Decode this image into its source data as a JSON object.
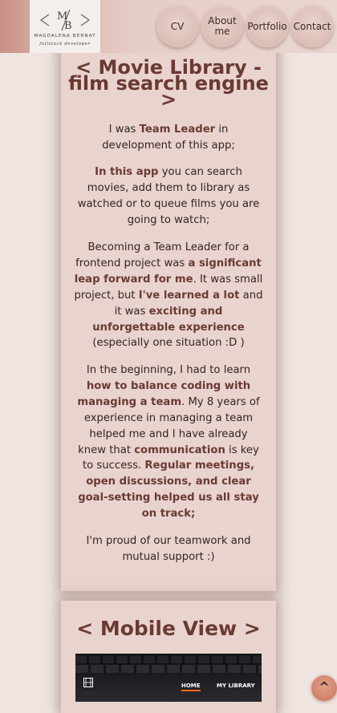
{
  "header": {
    "logo": {
      "monogram": "M/B",
      "name": "MAGDALENA BERNAT",
      "subtitle": "fullstack developer"
    },
    "nav": {
      "cv": "CV",
      "about": "About me",
      "portfolio": "Portfolio",
      "contact": "Contact"
    }
  },
  "project": {
    "title": "< Movie Library - film search engine >",
    "p1": {
      "a": "I was ",
      "b": "Team Leader",
      "c": " in development of this app;"
    },
    "p2": {
      "a": "In this app",
      "b": " you can search movies, add them to library as watched or to queue films you are going to watch;"
    },
    "p3": {
      "a": "Becoming a Team Leader for a frontend project was ",
      "b": "a significant leap forward for me",
      "c": ". It was small project, but ",
      "d": "I've learned a lot",
      "e": " and it was ",
      "f": "exciting and unforgettable experience",
      "g": " (especially one situation :D )"
    },
    "p4": {
      "a": "In the beginning, I had to learn ",
      "b": "how to balance coding with managing a team",
      "c": ". My 8 years of experience in managing a team helped me and I have already knew that ",
      "d": "communication",
      "e": " is key to success. ",
      "f": "Regular meetings, open discussions, and clear goal-setting helped us all stay on track;"
    },
    "p5": "I'm proud of our teamwork and mutual support :)"
  },
  "mobile": {
    "title": "< Mobile View >",
    "preview": {
      "home": "HOME",
      "library": "MY LIBRARY",
      "icon": "film-icon"
    }
  },
  "scroll_top": {
    "label": "^",
    "icon": "chevron-up-icon"
  },
  "colors": {
    "accent": "#6a3a32",
    "background": "#efe4e0",
    "card": "#e9d3ce",
    "preview_highlight": "#ff6b08"
  }
}
